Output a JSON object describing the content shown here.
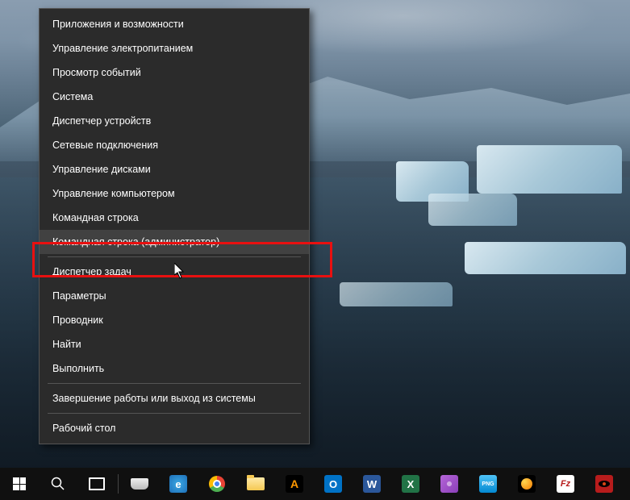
{
  "context_menu": {
    "items": [
      {
        "label": "Приложения и возможности",
        "id": "apps-features"
      },
      {
        "label": "Управление электропитанием",
        "id": "power-options"
      },
      {
        "label": "Просмотр событий",
        "id": "event-viewer"
      },
      {
        "label": "Система",
        "id": "system"
      },
      {
        "label": "Диспетчер устройств",
        "id": "device-manager"
      },
      {
        "label": "Сетевые подключения",
        "id": "network-connections"
      },
      {
        "label": "Управление дисками",
        "id": "disk-management"
      },
      {
        "label": "Управление компьютером",
        "id": "computer-management"
      },
      {
        "label": "Командная строка",
        "id": "command-prompt"
      },
      {
        "label": "Командная строка (администратор)",
        "id": "command-prompt-admin",
        "hovered": true,
        "highlighted": true
      },
      {
        "separator": true
      },
      {
        "label": "Диспетчер задач",
        "id": "task-manager"
      },
      {
        "label": "Параметры",
        "id": "settings"
      },
      {
        "label": "Проводник",
        "id": "file-explorer"
      },
      {
        "label": "Найти",
        "id": "search"
      },
      {
        "label": "Выполнить",
        "id": "run"
      },
      {
        "separator": true
      },
      {
        "label": "Завершение работы или выход из системы",
        "id": "shutdown-signout"
      },
      {
        "separator": true
      },
      {
        "label": "Рабочий стол",
        "id": "desktop"
      }
    ]
  },
  "taskbar": {
    "items": [
      {
        "id": "start",
        "name": "start-button"
      },
      {
        "id": "search",
        "name": "search-button"
      },
      {
        "id": "taskview",
        "name": "task-view-button"
      },
      {
        "id": "device",
        "name": "device-app"
      },
      {
        "id": "ie",
        "name": "internet-explorer",
        "letter": "e"
      },
      {
        "id": "chrome",
        "name": "google-chrome"
      },
      {
        "id": "explorer",
        "name": "file-explorer"
      },
      {
        "id": "aimp",
        "name": "aimp-player",
        "letter": "A"
      },
      {
        "id": "outlook",
        "name": "outlook",
        "letter": "O"
      },
      {
        "id": "word",
        "name": "word",
        "letter": "W"
      },
      {
        "id": "excel",
        "name": "excel",
        "letter": "X"
      },
      {
        "id": "lightshot",
        "name": "lightshot"
      },
      {
        "id": "png",
        "name": "png-tool",
        "letter": "PNG"
      },
      {
        "id": "orb",
        "name": "orb-app"
      },
      {
        "id": "filezilla",
        "name": "filezilla",
        "letter": "Fz"
      },
      {
        "id": "eye",
        "name": "eye-app"
      }
    ]
  }
}
